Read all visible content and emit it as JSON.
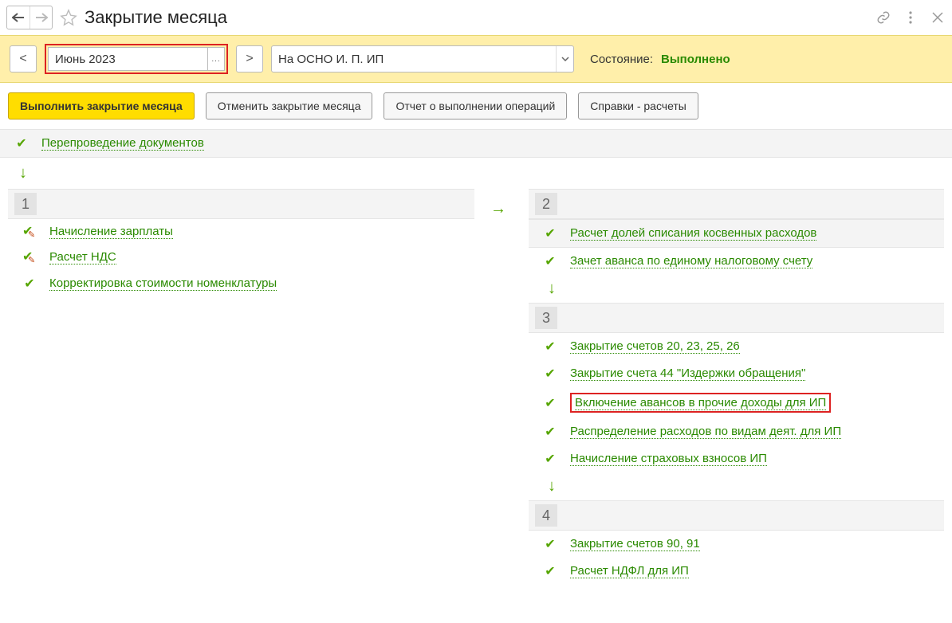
{
  "title": "Закрытие месяца",
  "period": {
    "value": "Июнь 2023"
  },
  "organization": {
    "value": "На ОСНО И. П. ИП"
  },
  "state": {
    "label": "Состояние:",
    "value": "Выполнено"
  },
  "actions": {
    "run": "Выполнить закрытие месяца",
    "cancel": "Отменить закрытие месяца",
    "report": "Отчет о выполнении операций",
    "refs": "Справки - расчеты"
  },
  "top_op": "Перепроведение документов",
  "block1": {
    "num": "1",
    "items": [
      "Начисление зарплаты",
      "Расчет НДС",
      "Корректировка стоимости номенклатуры"
    ]
  },
  "block2": {
    "num": "2",
    "items": [
      "Расчет долей списания косвенных расходов",
      "Зачет аванса по единому налоговому счету"
    ]
  },
  "block3": {
    "num": "3",
    "items": [
      "Закрытие счетов 20, 23, 25, 26",
      "Закрытие счета 44 \"Издержки обращения\"",
      "Включение авансов в прочие доходы для ИП",
      "Распределение расходов по видам деят. для ИП",
      "Начисление страховых взносов ИП"
    ]
  },
  "block4": {
    "num": "4",
    "items": [
      "Закрытие счетов 90, 91",
      "Расчет НДФЛ для ИП"
    ]
  }
}
